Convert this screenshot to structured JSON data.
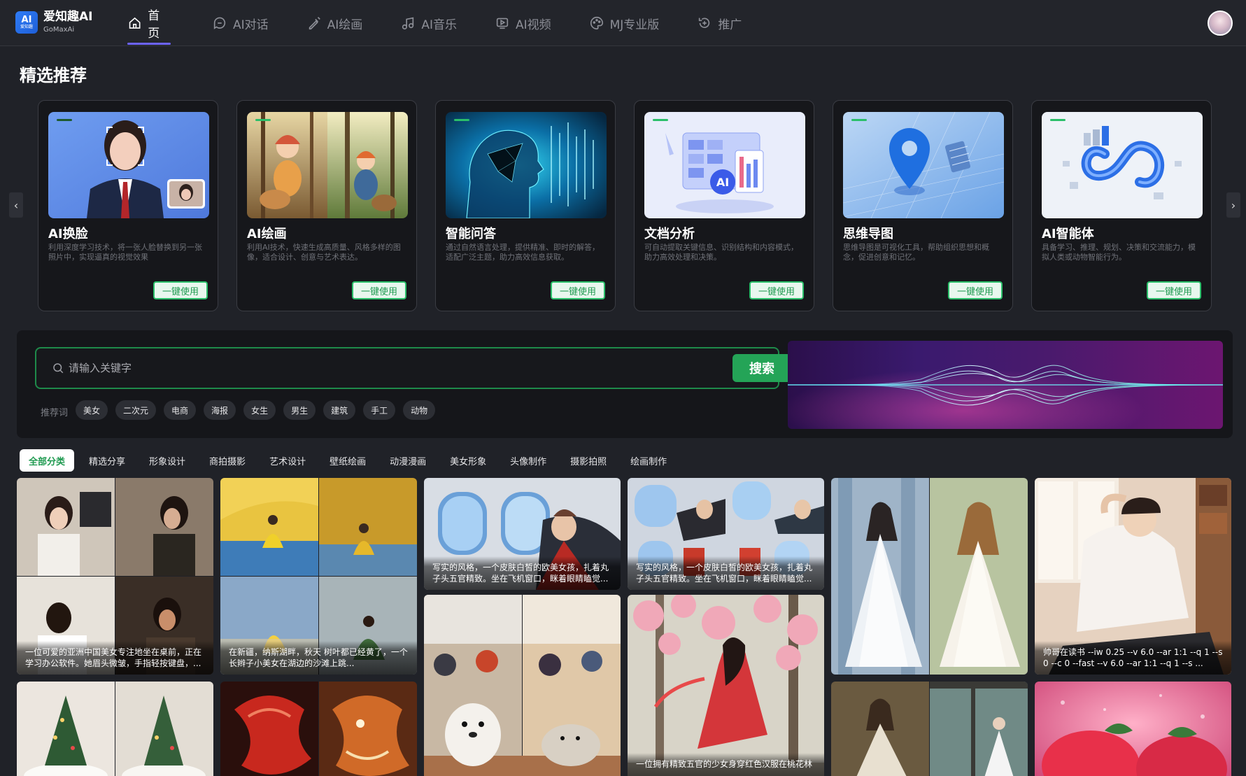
{
  "brand": {
    "name": "爱知趣AI",
    "sub": "GoMaxAi",
    "badge_top": "AI",
    "badge_bottom": "爱知趣"
  },
  "nav": [
    {
      "label": "首页",
      "icon": "home-icon",
      "active": true
    },
    {
      "label": "AI对话",
      "icon": "chat-icon"
    },
    {
      "label": "AI绘画",
      "icon": "paint-icon"
    },
    {
      "label": "AI音乐",
      "icon": "music-icon"
    },
    {
      "label": "AI视频",
      "icon": "video-icon"
    },
    {
      "label": "MJ专业版",
      "icon": "palette-icon"
    },
    {
      "label": "推广",
      "icon": "promote-icon"
    }
  ],
  "section_title": "精选推荐",
  "cards": [
    {
      "title": "AI换脸",
      "desc": "利用深度学习技术，将一张人脸替换到另一张照片中，实现逼真的视觉效果",
      "button": "一键使用"
    },
    {
      "title": "AI绘画",
      "desc": "利用AI技术，快速生成高质量、风格多样的图像，适合设计、创意与艺术表达。",
      "button": "一键使用"
    },
    {
      "title": "智能问答",
      "desc": "通过自然语言处理，提供精准、即时的解答，适配广泛主题，助力高效信息获取。",
      "button": "一键使用"
    },
    {
      "title": "文档分析",
      "desc": "可自动提取关键信息、识别结构和内容模式，助力高效处理和决策。",
      "button": "一键使用"
    },
    {
      "title": "思维导图",
      "desc": "思维导图是可视化工具，帮助组织思想和概念，促进创意和记忆。",
      "button": "一键使用"
    },
    {
      "title": "AI智能体",
      "desc": "具备学习、推理、规划、决策和交流能力，模拟人类或动物智能行为。",
      "button": "一键使用"
    }
  ],
  "search": {
    "placeholder": "请输入关键字",
    "button": "搜索",
    "hot_label": "推荐词",
    "hot_tags": [
      "美女",
      "二次元",
      "电商",
      "海报",
      "女生",
      "男生",
      "建筑",
      "手工",
      "动物"
    ]
  },
  "categories": [
    {
      "label": "全部分类",
      "active": true
    },
    {
      "label": "精选分享"
    },
    {
      "label": "形象设计"
    },
    {
      "label": "商拍摄影"
    },
    {
      "label": "艺术设计"
    },
    {
      "label": "壁纸绘画"
    },
    {
      "label": "动漫漫画"
    },
    {
      "label": "美女形象"
    },
    {
      "label": "头像制作"
    },
    {
      "label": "摄影拍照"
    },
    {
      "label": "绘画制作"
    }
  ],
  "gallery": {
    "captions": {
      "t1": "一位可爱的亚洲中国美女专注地坐在桌前，正在学习办公软件。她眉头微皱，手指轻按键盘，...",
      "t2": "在新疆，纳斯湖畔，秋天 树叶都已经黄了，一个长辫子小美女在湖边的沙滩上跳...",
      "t3": "写实的风格，一个皮肤白皙的欧美女孩，扎着丸子头五官精致。坐在飞机窗口，眯着眼睛瞌觉...",
      "t4": "写实的风格，一个皮肤白皙的欧美女孩，扎着丸子头五官精致。坐在飞机窗口，眯着眼睛瞌觉...",
      "t6": "帅哥在读书 --iw 0.25 --v 6.0 --ar 1:1 --q 1 --s 0 --c 0 --fast --v 6.0 --ar 1:1 --q 1 --s ...",
      "t9": "一位拥有精致五官的少女身穿红色汉服在桃花林"
    }
  },
  "colors": {
    "accent": "#2bbf6a",
    "nav_active": "#6c63ff",
    "search_btn": "#24a457"
  }
}
